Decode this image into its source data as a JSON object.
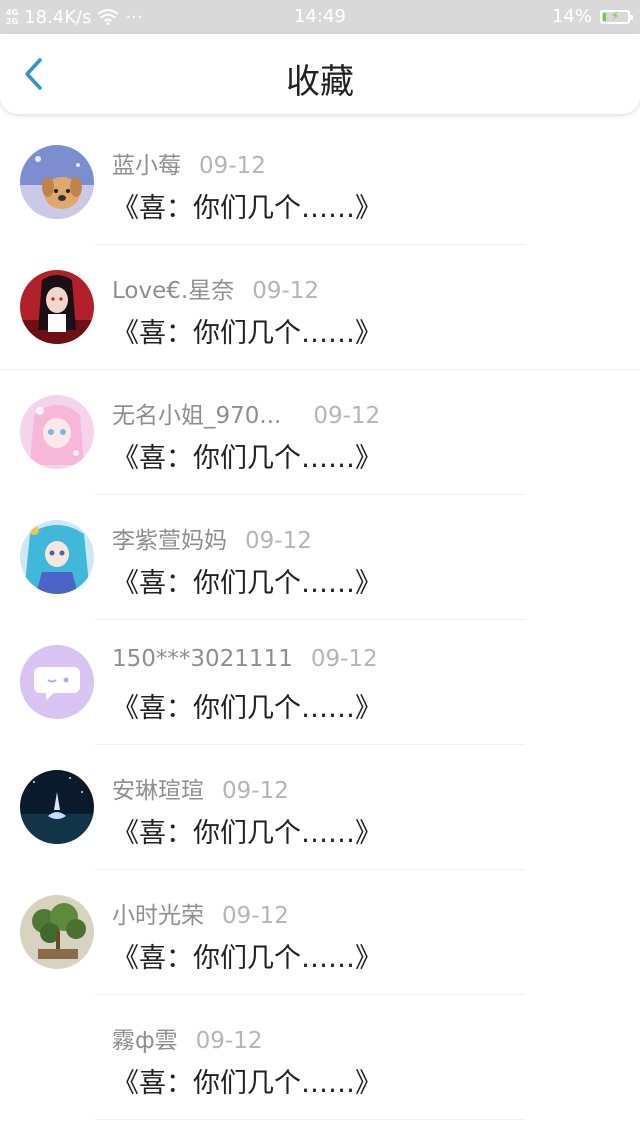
{
  "status_bar": {
    "network_top": "4G",
    "network_bottom": "2G",
    "speed": "18.4K/s",
    "more": "···",
    "time": "14:49",
    "battery": "14%",
    "battery_level": 0.14
  },
  "header": {
    "title": "收藏",
    "accent_color": "#2a94e0"
  },
  "items": [
    {
      "name": "蓝小莓",
      "date": "09-12",
      "message": "《喜：你们几个……》",
      "avatar_icon": "puppy-avatar"
    },
    {
      "name": "Love€.星奈",
      "date": "09-12",
      "message": "《喜：你们几个……》",
      "avatar_icon": "anime-girl-red-avatar"
    },
    {
      "name": "无名小姐_970...",
      "date": "09-12",
      "message": "《喜：你们几个……》",
      "avatar_icon": "anime-girl-pink-avatar"
    },
    {
      "name": "李紫萱妈妈",
      "date": "09-12",
      "message": "《喜：你们几个……》",
      "avatar_icon": "anime-girl-blue-avatar"
    },
    {
      "name": "150***3021111",
      "date": "09-12",
      "message": "《喜：你们几个……》",
      "avatar_icon": "default-chat-avatar"
    },
    {
      "name": "安琳瑄瑄",
      "date": "09-12",
      "message": "《喜：你们几个……》",
      "avatar_icon": "night-scene-avatar"
    },
    {
      "name": "小时光荣",
      "date": "09-12",
      "message": "《喜：你们几个……》",
      "avatar_icon": "bonsai-avatar"
    },
    {
      "name": "霧ф雲",
      "date": "09-12",
      "message": "《喜：你们几个……》",
      "avatar_icon": "no-avatar"
    }
  ]
}
